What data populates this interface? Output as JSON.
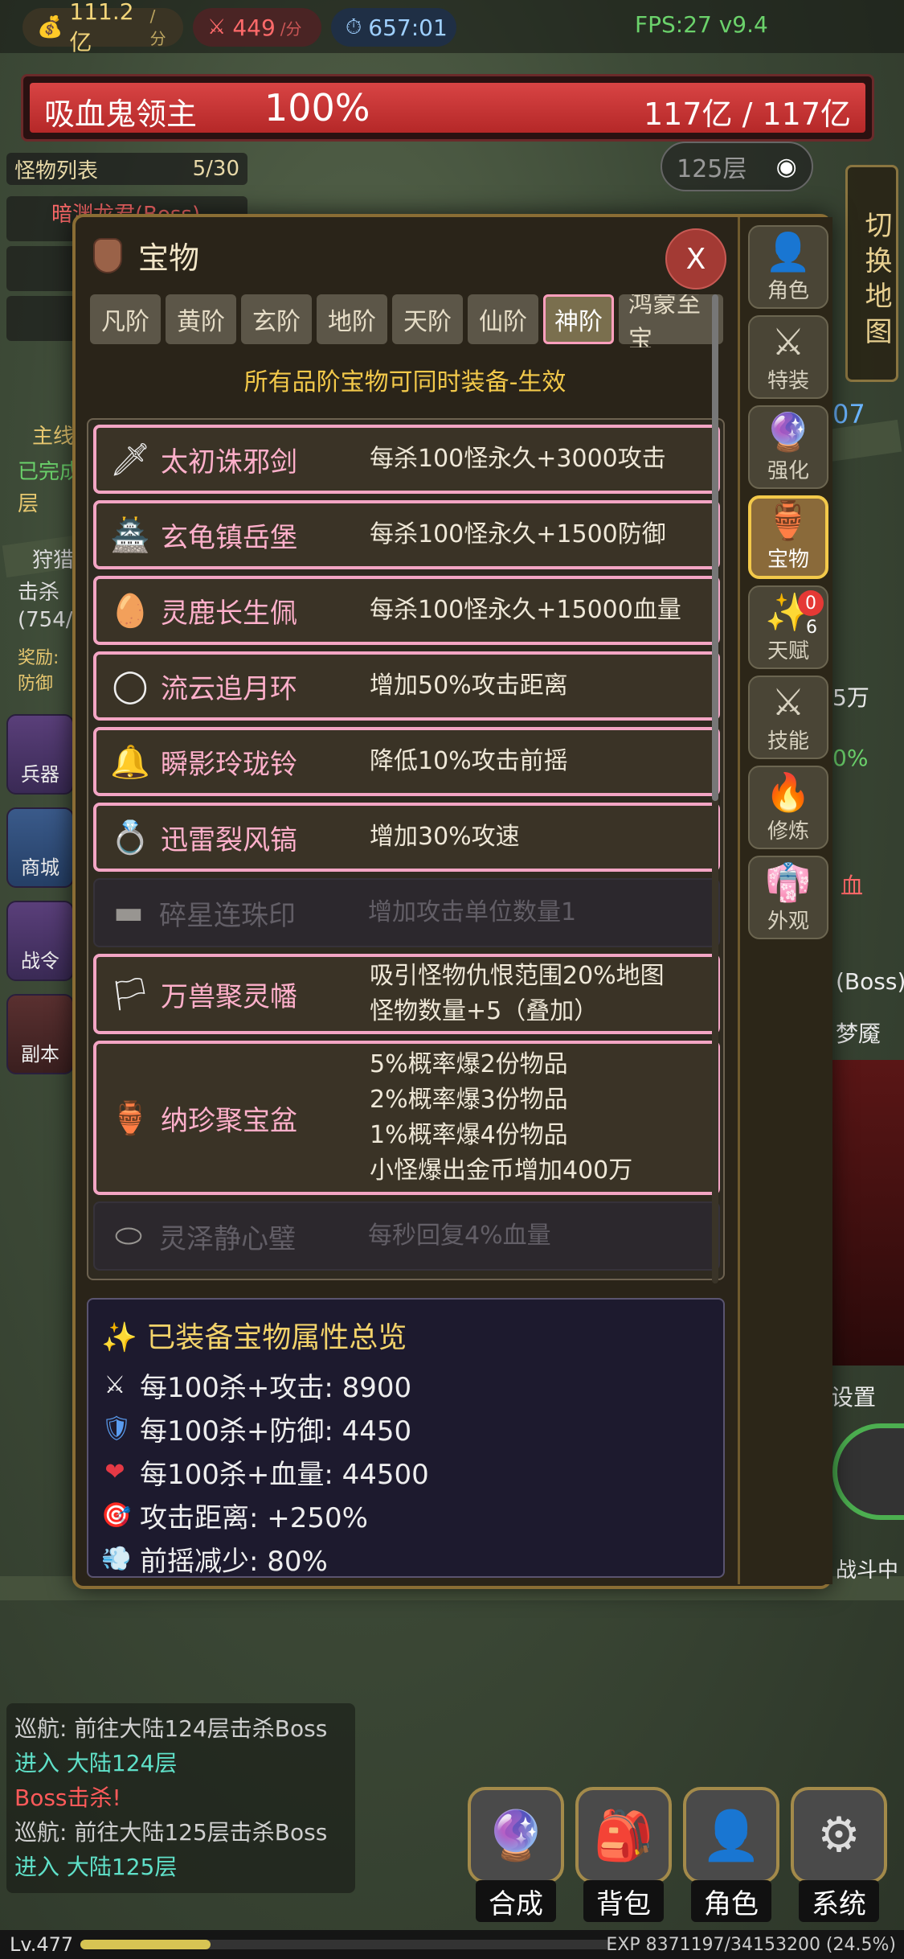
{
  "top": {
    "gold": "111.2亿",
    "gold_unit": "/分",
    "kills": "449",
    "kills_unit": "/分",
    "time": "657:01",
    "fps": "FPS:27 v9.4"
  },
  "boss": {
    "name": "吸血鬼领主",
    "percent": "100%",
    "hp": "117亿 / 117亿",
    "fill_fraction": 1.0
  },
  "behind": {
    "monster_list_title": "怪物列表",
    "monster_count": "5/30",
    "monster_first": "暗渊龙君(Boss)",
    "floor": "125层",
    "switch_map": "切换地图",
    "left_labels": [
      "主线",
      "已完成",
      "层",
      "狩猎",
      "击杀",
      "(754/",
      "奖励:",
      "防御"
    ],
    "side_buttons": [
      "兵器",
      "商城",
      "战令",
      "副本"
    ],
    "right_labels": [
      "07",
      "5万",
      "0%",
      "血",
      "(Boss)",
      "梦魇",
      "设置",
      "战斗中"
    ]
  },
  "modal": {
    "title": "宝物",
    "close": "X",
    "tabs": [
      "凡阶",
      "黄阶",
      "玄阶",
      "地阶",
      "天阶",
      "仙阶",
      "神阶",
      "鸿蒙至宝"
    ],
    "active_tab": "神阶",
    "notice": "所有品阶宝物可同时装备-生效",
    "items": [
      {
        "name": "太初诛邪剑",
        "effect": [
          "每杀100怪永久+3000攻击"
        ],
        "icon": "sword-icon",
        "glyph": "🗡",
        "enabled": true
      },
      {
        "name": "玄龟镇岳堡",
        "effect": [
          "每杀100怪永久+1500防御"
        ],
        "icon": "fortress-icon",
        "glyph": "🏯",
        "enabled": true
      },
      {
        "name": "灵鹿长生佩",
        "effect": [
          "每杀100怪永久+15000血量"
        ],
        "icon": "jade-icon",
        "glyph": "🥚",
        "enabled": true
      },
      {
        "name": "流云追月环",
        "effect": [
          "增加50%攻击距离"
        ],
        "icon": "ring-icon",
        "glyph": "◯",
        "enabled": true
      },
      {
        "name": "瞬影玲珑铃",
        "effect": [
          "降低10%攻击前摇"
        ],
        "icon": "bell-icon",
        "glyph": "🔔",
        "enabled": true
      },
      {
        "name": "迅雷裂风镐",
        "effect": [
          "增加30%攻速"
        ],
        "icon": "bracelet-icon",
        "glyph": "💍",
        "enabled": true
      },
      {
        "name": "碎星连珠印",
        "effect": [
          "增加攻击单位数量1"
        ],
        "icon": "seal-icon",
        "glyph": "▬",
        "enabled": false
      },
      {
        "name": "万兽聚灵幡",
        "effect": [
          "吸引怪物仇恨范围20%地图",
          "怪物数量+5（叠加）"
        ],
        "icon": "banner-icon",
        "glyph": "🏳",
        "enabled": true
      },
      {
        "name": "纳珍聚宝盆",
        "effect": [
          "5%概率爆2份物品",
          "2%概率爆3份物品",
          "1%概率爆4份物品",
          "小怪爆出金币增加400万"
        ],
        "icon": "treasure-bowl-icon",
        "glyph": "🏺",
        "enabled": true
      },
      {
        "name": "灵泽静心璧",
        "effect": [
          "每秒回复4%血量"
        ],
        "icon": "disc-icon",
        "glyph": "⬭",
        "enabled": false
      }
    ],
    "summary": {
      "title": "已装备宝物属性总览",
      "rows": [
        {
          "icon": "swords-icon",
          "glyph": "⚔",
          "text": "每100杀+攻击: 8900"
        },
        {
          "icon": "shield-icon",
          "glyph": "🛡",
          "text": "每100杀+防御: 4450"
        },
        {
          "icon": "heart-icon",
          "glyph": "❤",
          "text": "每100杀+血量: 44500"
        },
        {
          "icon": "target-icon",
          "glyph": "🎯",
          "text": "攻击距离: +250%"
        },
        {
          "icon": "wind-icon",
          "glyph": "💨",
          "text": "前摇减少: 80%"
        }
      ]
    }
  },
  "rail": [
    {
      "label": "角色",
      "icon": "person-icon",
      "glyph": "👤"
    },
    {
      "label": "特装",
      "icon": "crossed-swords-icon",
      "glyph": "⚔"
    },
    {
      "label": "强化",
      "icon": "orb-icon",
      "glyph": "🔮"
    },
    {
      "label": "宝物",
      "icon": "vase-icon",
      "glyph": "🏺",
      "active": true
    },
    {
      "label": "天赋",
      "icon": "sparkle-icon",
      "glyph": "✨",
      "badge": "0",
      "count": "6"
    },
    {
      "label": "技能",
      "icon": "crossed-swords-icon",
      "glyph": "⚔"
    },
    {
      "label": "修炼",
      "icon": "fire-icon",
      "glyph": "🔥"
    },
    {
      "label": "外观",
      "icon": "robe-icon",
      "glyph": "👘"
    }
  ],
  "log": [
    {
      "text": "巡航: 前往大陆124层击杀Boss",
      "color": "#cfcfcf"
    },
    {
      "text": "进入 大陆124层",
      "color": "#5fe0c8"
    },
    {
      "text": "Boss击杀!",
      "color": "#ff5a5a"
    },
    {
      "text": "巡航: 前往大陆125层击杀Boss",
      "color": "#cfcfcf"
    },
    {
      "text": "进入 大陆125层",
      "color": "#5fe0c8"
    }
  ],
  "bottom_buttons": [
    {
      "label": "合成",
      "icon": "crystal-ball-icon",
      "glyph": "🔮"
    },
    {
      "label": "背包",
      "icon": "backpack-icon",
      "glyph": "🎒"
    },
    {
      "label": "角色",
      "icon": "person-icon",
      "glyph": "👤"
    },
    {
      "label": "系统",
      "icon": "gear-icon",
      "glyph": "⚙"
    }
  ],
  "level": {
    "lv": "Lv.477",
    "exp": "EXP 8371197/34153200 (24.5%)",
    "fraction": 0.245
  }
}
